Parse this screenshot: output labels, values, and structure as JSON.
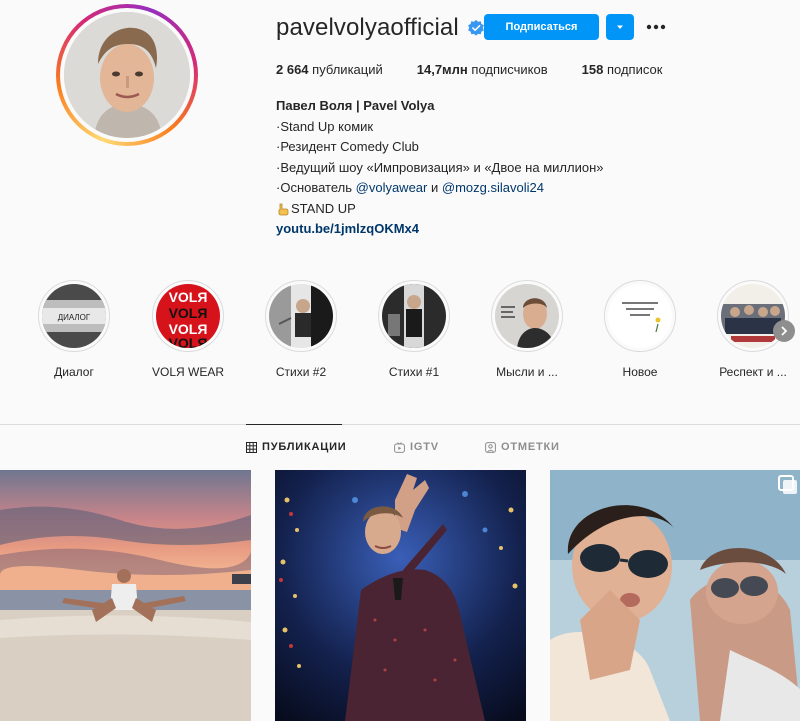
{
  "profile": {
    "username": "pavelvolyaofficial",
    "verified": true,
    "follow_label": "Подписаться",
    "stats": [
      {
        "count": "2 664",
        "label": "публикаций"
      },
      {
        "count": "14,7млн",
        "label": "подписчиков"
      },
      {
        "count": "158",
        "label": "подписок"
      }
    ],
    "bio": {
      "name": "Павел Воля | Pavel Volya",
      "line1": "·Stand Up комик",
      "line2": "·Резидент Comedy Club",
      "line3": "·Ведущий шоу «Импровизация» и «Двое на миллион»",
      "line4_prefix": "·Основатель ",
      "mention1": "@volyawear",
      "line4_mid": " и ",
      "mention2": "@mozg.silavoli24",
      "line5": "STAND UP",
      "url": "youtu.be/1jmlzqOKMx4"
    }
  },
  "highlights": [
    {
      "label": "Диалог",
      "caption": "ДИАЛОГ"
    },
    {
      "label": "VOLЯ WEAR",
      "caption": "VOLЯ"
    },
    {
      "label": "Стихи #2",
      "caption": ""
    },
    {
      "label": "Стихи #1",
      "caption": ""
    },
    {
      "label": "Мысли и ...",
      "caption": ""
    },
    {
      "label": "Новое",
      "caption": ""
    },
    {
      "label": "Респект и ...",
      "caption": ""
    }
  ],
  "tabs": [
    {
      "label": "ПУБЛИКАЦИИ",
      "icon": "grid-icon",
      "active": true
    },
    {
      "label": "IGTV",
      "icon": "igtv-icon",
      "active": false
    },
    {
      "label": "ОТМЕТКИ",
      "icon": "tagged-icon",
      "active": false
    }
  ],
  "colors": {
    "accent": "#0095f6",
    "text": "#262626",
    "muted": "#8e8e8e",
    "link": "#00376b"
  }
}
